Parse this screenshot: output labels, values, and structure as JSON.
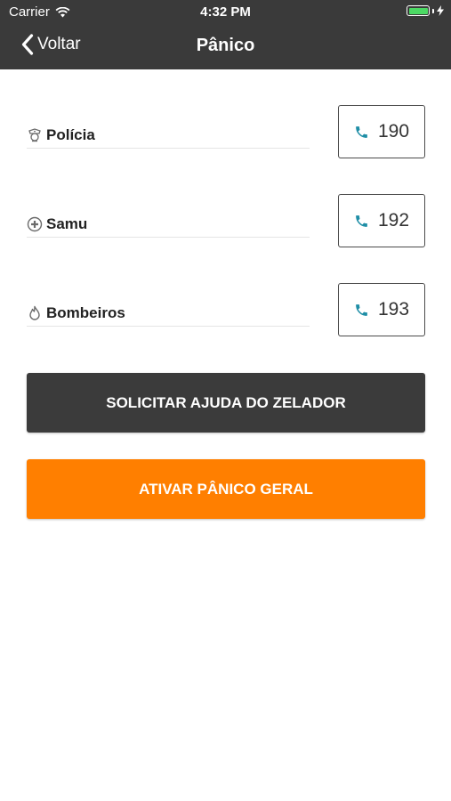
{
  "status_bar": {
    "carrier": "Carrier",
    "time": "4:32 PM",
    "battery_color": "#4cd964"
  },
  "nav": {
    "back_label": "Voltar",
    "title": "Pânico"
  },
  "contacts": [
    {
      "label": "Polícia",
      "number": "190",
      "icon": "police-icon"
    },
    {
      "label": "Samu",
      "number": "192",
      "icon": "medical-cross-icon"
    },
    {
      "label": "Bombeiros",
      "number": "193",
      "icon": "flame-icon"
    }
  ],
  "actions": {
    "help_label": "SOLICITAR AJUDA DO ZELADOR",
    "panic_label": "ATIVAR PÂNICO GERAL"
  },
  "colors": {
    "header": "#3a3a3a",
    "phone_icon": "#1f8ea6",
    "accent": "#ff7f00",
    "dark_button": "#3b3b3b"
  }
}
